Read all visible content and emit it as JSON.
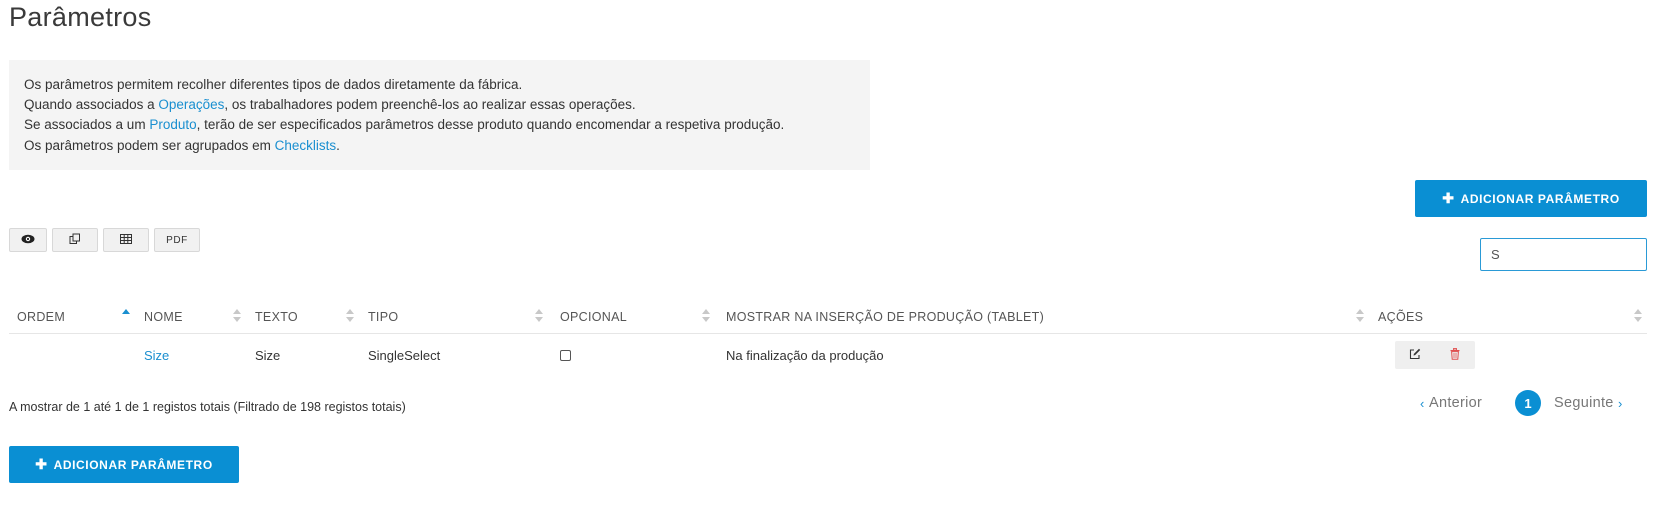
{
  "page": {
    "title": "Parâmetros"
  },
  "info": {
    "line1": "Os parâmetros permitem recolher diferentes tipos de dados diretamente da fábrica.",
    "line2_pre": "Quando associados a ",
    "line2_link": "Operações",
    "line2_post": ", os trabalhadores podem preenchê-los ao realizar essas operações.",
    "line3_pre": "Se associados a um ",
    "line3_link": "Produto",
    "line3_post": ", terão de ser especificados parâmetros desse produto quando encomendar a respetiva produção.",
    "line4_pre": "Os parâmetros podem ser agrupados em ",
    "line4_link": "Checklists",
    "line4_post": "."
  },
  "buttons": {
    "add_label": "ADICIONAR PARÂMETRO",
    "add_icon": "plus-icon"
  },
  "toolbar": {
    "view_icon": "eye-icon",
    "copy_icon": "copy-icon",
    "excel_icon": "table-icon",
    "pdf_label": "PDF"
  },
  "search": {
    "value": "S"
  },
  "table": {
    "columns": [
      "ORDEM",
      "NOME",
      "TEXTO",
      "TIPO",
      "OPCIONAL",
      "MOSTRAR NA INSERÇÃO DE PRODUÇÃO (TABLET)",
      "AÇÕES"
    ],
    "sorted_column": "ORDEM",
    "rows": [
      {
        "ordem": "",
        "nome": "Size",
        "texto": "Size",
        "tipo": "SingleSelect",
        "opcional": false,
        "mostrar": "Na finalização da produção"
      }
    ]
  },
  "footer": {
    "info": "A mostrar de 1 até 1 de 1 registos totais (Filtrado de 198 registos totais)",
    "prev_label": "Anterior",
    "next_label": "Seguinte",
    "current_page": "1"
  },
  "colors": {
    "accent": "#0a8fd3",
    "link": "#1a8fd0",
    "info_bg": "#f4f4f4",
    "delete": "#e05050"
  }
}
